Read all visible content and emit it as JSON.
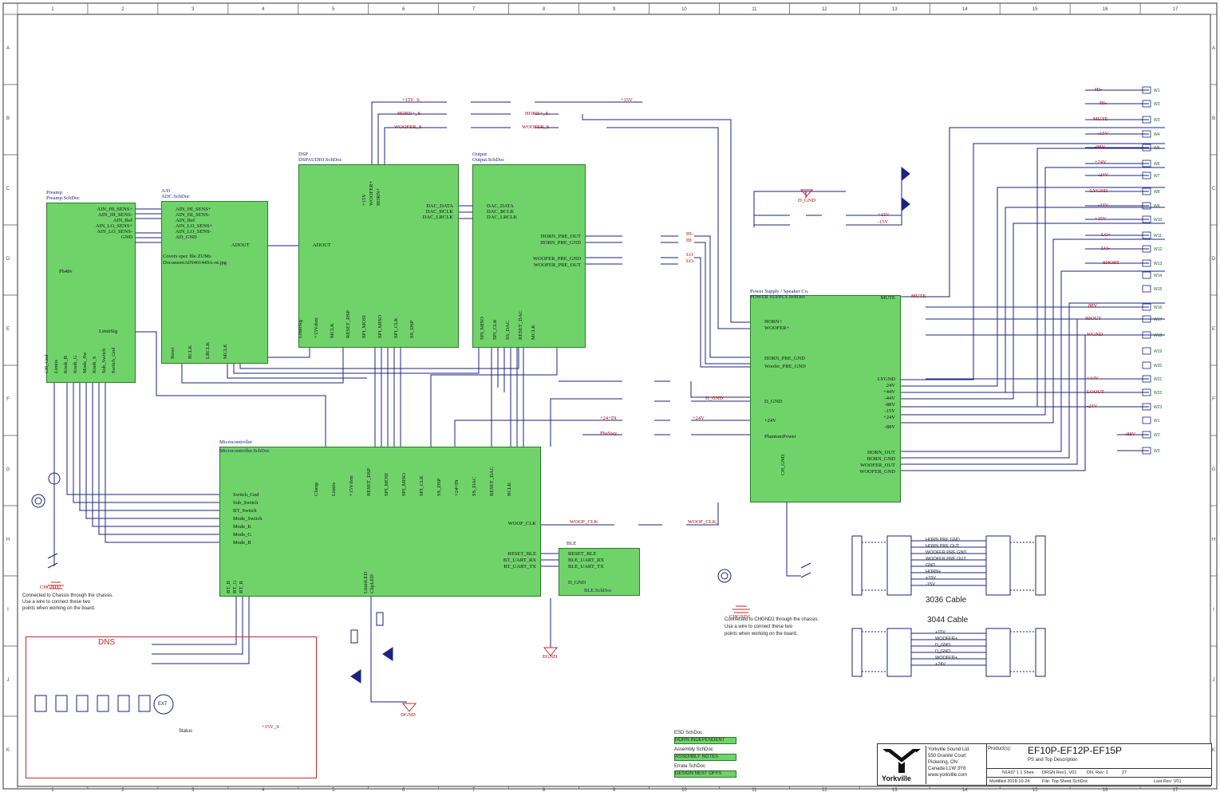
{
  "colors": {
    "block_fill": "#6fd36a",
    "block_border": "#2a7a2a",
    "wire": "#1a237e",
    "net_label": "#b00000",
    "dns_box": "#c62828",
    "frame": "#333333"
  },
  "frame": {
    "cols": [
      "1",
      "2",
      "3",
      "4",
      "5",
      "6",
      "7",
      "8",
      "9",
      "10",
      "11",
      "12",
      "13",
      "14",
      "15",
      "16",
      "17"
    ],
    "rows": [
      "A",
      "B",
      "C",
      "D",
      "E",
      "F",
      "G",
      "H",
      "I",
      "J",
      "K"
    ]
  },
  "blocks": {
    "preamp": {
      "title": "Preamp",
      "file": "Preamp.SchDoc",
      "right_pins": [
        "AIN_HI_SENS+",
        "AIN_HI_SENS-",
        "AIN_Ref",
        "AIN_LO_SENS+",
        "AIN_LO_SENS-",
        "GND"
      ],
      "left_pins": [
        "Ph48v"
      ],
      "side_pin": "LimitSig",
      "bottom_pins": [
        "CH_Gnd",
        "Limits",
        "Knob_B",
        "Knob_G",
        "Mode_Sw",
        "Knob_S",
        "Sub_Switch",
        "Switch_Gnd"
      ]
    },
    "ad": {
      "title": "A/D",
      "file": "ADC.SchDoc",
      "left_pins": [
        "AIN_HI_SENS+",
        "AIN_HI_SENS-",
        "AIN_Ref",
        "AIN_LO_SENS+",
        "AIN_LO_SENS-",
        "AD_GND"
      ],
      "note_line1": "Covers spec file ZUMs",
      "note_line2": "DocumentAIN401449A-nt.jpg",
      "right_pin": "ADOUT",
      "bottom_pins": [
        "Reset",
        "BCLK",
        "LRCLK",
        "MCLK"
      ]
    },
    "dsp": {
      "title": "DSP",
      "file": "DSPAUDIO.SchDoc",
      "top_pins": [
        "+15V",
        "WOOFER+",
        "HORN+"
      ],
      "left_pin": "ADOUT",
      "right_pins": [
        "DAC_DATA",
        "DAC_BCLK",
        "DAC_LRCLK"
      ],
      "bottom_pins": [
        "LimitSig",
        "+15Vdsm",
        "MCLK",
        "RESET_DSP",
        "SPI_MOSI",
        "SPI_MISO",
        "SPI_CLK",
        "SS_DSP"
      ]
    },
    "output": {
      "title": "Output",
      "file": "Output.SchDoc",
      "left_pins": [
        "DAC_DATA",
        "DAC_BCLK",
        "DAC_LRCLK"
      ],
      "right_pins": [
        "HORN_PRE_OUT",
        "HORN_PRE_GND",
        "WOOFER_PRE_GND",
        "WOOFER_PRE_OUT"
      ],
      "bottom_pins": [
        "SPI_MISO",
        "SPI_CLK",
        "SS_DAC",
        "RESET_DAC",
        "MCLK"
      ]
    },
    "psu": {
      "title": "Power Supply / Speaker Co.",
      "file": "POWER SUPPLY.SchDoc",
      "left_pins": [
        "HORN+",
        "WOOFER+",
        "HORN_PRE_GND",
        "Woofer_PRE_GND",
        "D_GND",
        "+24V",
        "PhantomPower"
      ],
      "right_pins": [
        "MUTE",
        "LYGND",
        "24V",
        "+44V",
        "-44V",
        "-88V",
        "-15V",
        "+24V",
        "-88V",
        "HORN_OUT",
        "HORN_GND",
        "WOOFER_OUT",
        "WOOFER_GND"
      ],
      "bottom_pin": "CH_GND"
    },
    "micro": {
      "title": "Microcontroller",
      "file": "Microcontroller.SchDoc",
      "left_pins": [
        "Switch_Gnd",
        "Sub_Switch",
        "BT_Switch",
        "Mode_Switch",
        "Mode_K",
        "Mode_G",
        "Mode_B"
      ],
      "top_pins": [
        "Clamp",
        "Limits",
        "+15Vdsm",
        "RESET_DSP",
        "SPI_MOSI",
        "SPI_MISO",
        "SPI_CLK",
        "SS_DSP",
        "+24+IN",
        "SS_DAC",
        "RESET_DAC",
        "BCLK"
      ],
      "right_pins": [
        "WOOF_CLK",
        "RESET_BLE",
        "BT_UART_RX",
        "BT_UART_TX"
      ],
      "bottom_pins": [
        "BT_B",
        "BT_G",
        "BT_R",
        "LimitLED",
        "ClipLED"
      ]
    },
    "ble": {
      "title": "BLE",
      "file": "BLE.SchDoc",
      "left_pins": [
        "RESET_BLE",
        "BLE_UART_RX",
        "BLE_UART_TX",
        "D_GND"
      ]
    }
  },
  "nets": {
    "top": [
      "+15V_S",
      "HORN+_S",
      "WOOFER_S",
      "+15V"
    ],
    "mid": [
      "+24+IN",
      "PhaSwy",
      "D_GND",
      "+24V_",
      "WOOF_CLK",
      "WOOF_CLK_",
      "-15V",
      "+15V",
      "D GND"
    ],
    "right": [
      "HI-",
      "HI-",
      "MUTE",
      "-15V",
      "-88V",
      "+24V",
      "-24V",
      "LYGND",
      "-44V",
      "+15V",
      "LO+",
      "LO-",
      "SHORT",
      "88V",
      "HIOUT",
      "WGND",
      "+44V",
      "LOOUT",
      "-24V",
      "-88V"
    ],
    "hilo": [
      "HI-",
      "HI",
      "LO",
      "LO-"
    ],
    "gnd": [
      "EGND",
      "DGND",
      "D_GND",
      "CHGND2",
      "CHGND1"
    ]
  },
  "connectors": [
    "W1",
    "W2",
    "W3",
    "W4",
    "W5",
    "W6",
    "W7",
    "W8",
    "W9",
    "W10",
    "W11",
    "W12",
    "W13",
    "W14",
    "W15",
    "W16",
    "W17",
    "W18",
    "W19",
    "W20",
    "W21",
    "W22",
    "W23"
  ],
  "notes": {
    "left": [
      "Connected to Chassis through the chassis.",
      "Use a wire to connect these two",
      "points when working on the board."
    ],
    "right": [
      "Connected to CHGND2 through the chassis.",
      "Use a wire to connect these two",
      "points when working on the board."
    ]
  },
  "dns": {
    "title": "DNS",
    "buzzer": "EXT",
    "status": "Status",
    "net": "+15V_S"
  },
  "cables": [
    {
      "title": "3036 Cable",
      "rows": [
        "HORN PRE GND",
        "HORN PRE OUT",
        "WOOFER PRE GND",
        "WOOFER PRE OUT",
        "GND",
        "HORN+",
        "+15V",
        "-15V"
      ]
    },
    {
      "title": "3044 Cable",
      "rows": [
        "+15V",
        "WOOFER+",
        "D_GND",
        "D_GND",
        "WOOFER+",
        "+24V"
      ]
    }
  ],
  "subsheets": [
    "ESD SchDoc",
    "HORN INDEPENDENT",
    "Assembly SchDoc",
    "ASSEMBLY NOTES",
    "Errata SchDoc",
    "DESIGN NEST OFFS"
  ],
  "title_block": {
    "logo": "Yorkville",
    "company": [
      "Yorkville Sound Ltd.",
      "550 Granite Court",
      "Pickering, ON",
      "Canada L1W 3Y8",
      "www.yorkville.com"
    ],
    "product_label": "Product(s):",
    "product": "EF10P-EF12P-EF15P",
    "description": "PS and Top Description",
    "row1": [
      "N1437 1 1 Shee",
      "DRGN Rev1, V01",
      "DN. Rev: 1",
      "27"
    ],
    "row2": [
      "Modified 2018-10-24",
      "File: Top Sheet.SchDoc",
      "Last Rev: V01"
    ]
  }
}
